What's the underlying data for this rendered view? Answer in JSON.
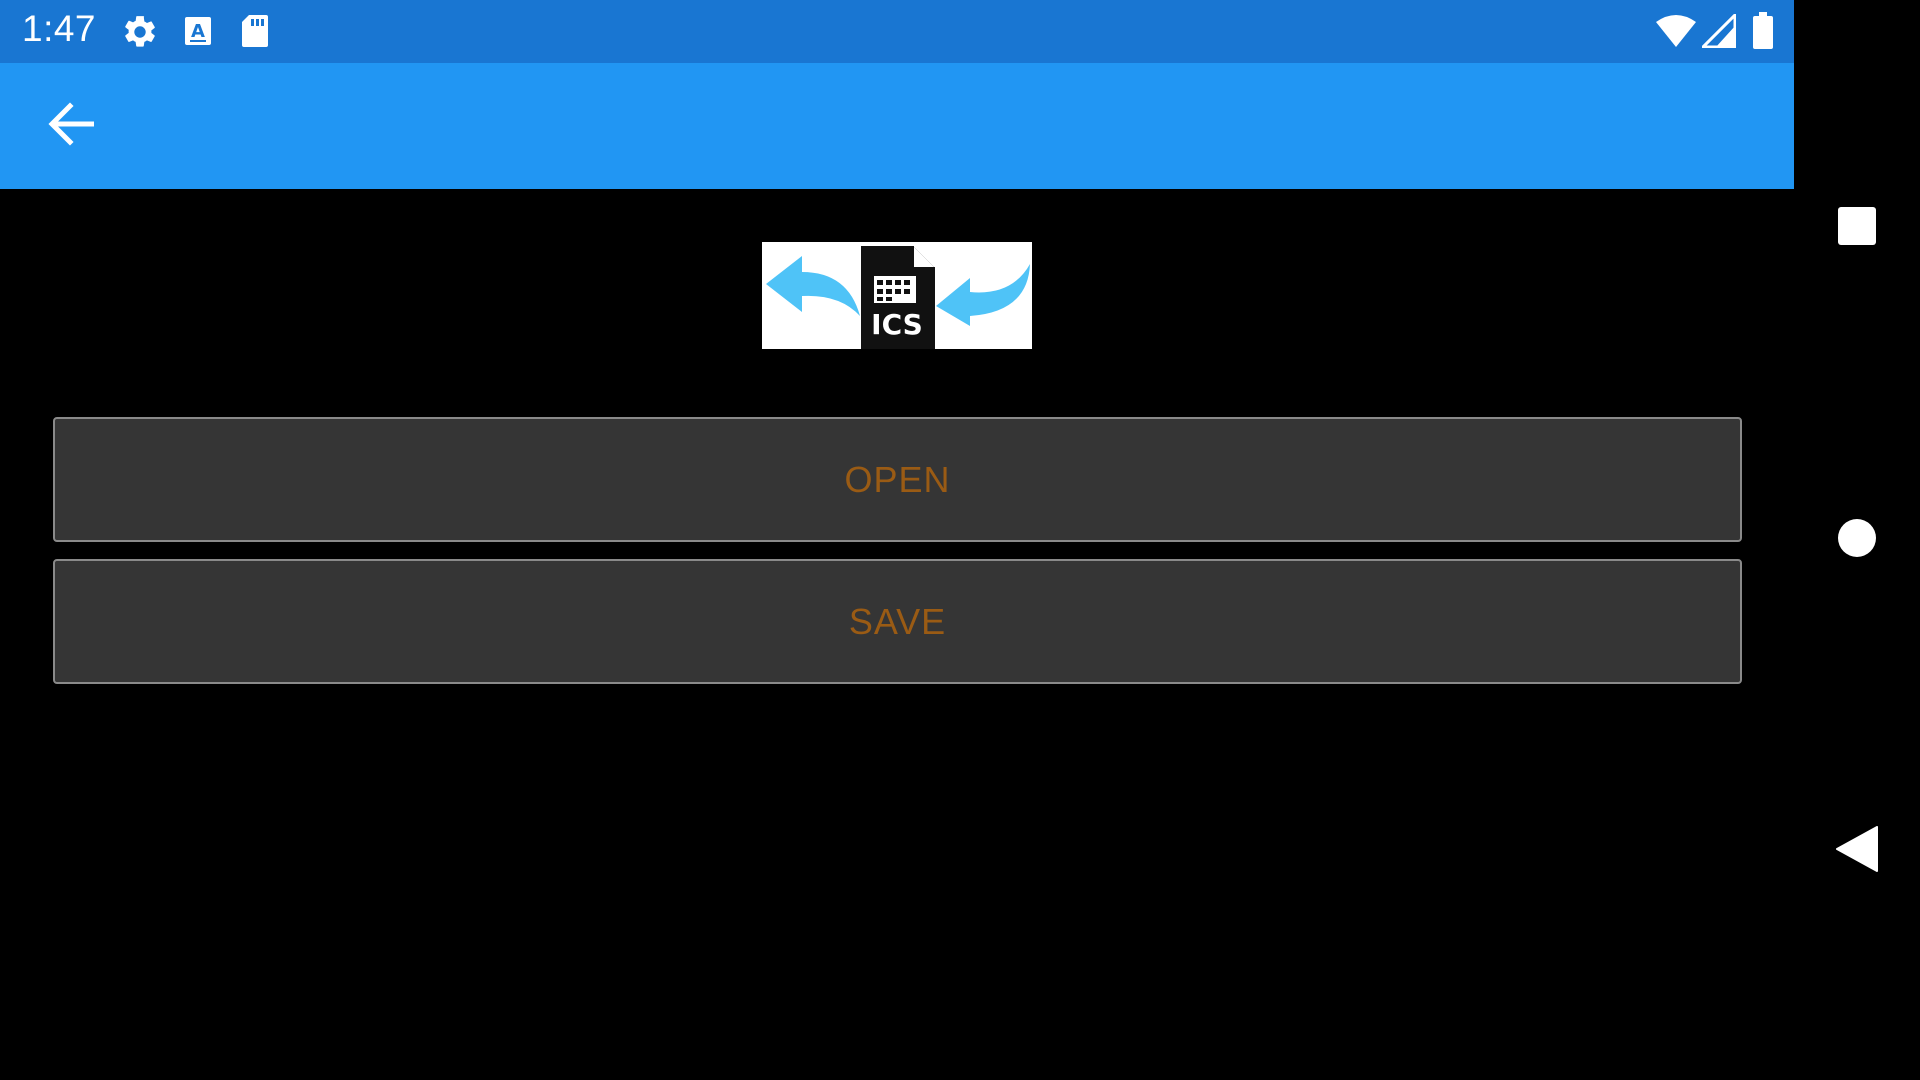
{
  "status_bar": {
    "time": "1:47",
    "icons": [
      "gear-icon",
      "text-a-icon",
      "sd-card-icon",
      "wifi-icon",
      "signal-icon",
      "battery-icon"
    ],
    "background": "#1976d2"
  },
  "app_bar": {
    "background": "#2196f3",
    "back_icon": "arrow-back-icon"
  },
  "logo": {
    "caption": "ICS",
    "icons": [
      "arrow-left-icon",
      "calendar-file-icon",
      "arrow-in-icon"
    ],
    "arrow_color": "#4fc3f7"
  },
  "buttons": {
    "open_label": "OPEN",
    "save_label": "SAVE",
    "text_color": "#9a5b14",
    "background": "#353535"
  },
  "nav_bar": {
    "icons": [
      "recents-square-icon",
      "home-circle-icon",
      "back-triangle-icon"
    ]
  }
}
